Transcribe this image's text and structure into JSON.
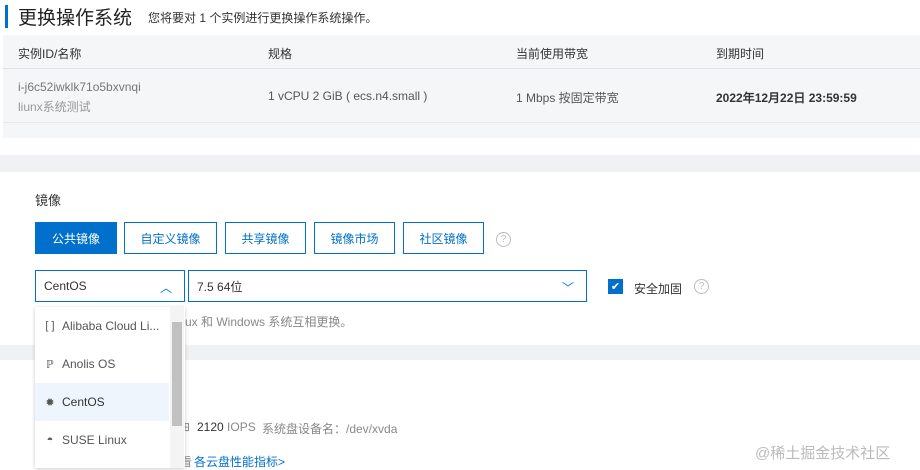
{
  "header": {
    "title": "更换操作系统",
    "subtitle": "您将要对 1 个实例进行更换操作系统操作。"
  },
  "table": {
    "columns": [
      "实例ID/名称",
      "规格",
      "当前使用带宽",
      "到期时间"
    ],
    "row": {
      "id": "i-j6c52iwklk71o5bxvnqi",
      "name": "liunx系统测试",
      "spec": "1 vCPU 2 GiB ( ecs.n4.small )",
      "bandwidth": "1 Mbps 按固定带宽",
      "expire": "2022年12月22日 23:59:59"
    }
  },
  "image": {
    "label": "镜像",
    "tabs": [
      "公共镜像",
      "自定义镜像",
      "共享镜像",
      "镜像市场",
      "社区镜像"
    ],
    "os_value": "CentOS",
    "version_value": "7.5 64位",
    "security_label": "安全加固",
    "security_checked": true,
    "hint": "ux 和 Windows 系统互相更换。",
    "options": [
      {
        "label": "Alibaba Cloud Li...",
        "icon": "alibaba-cloud-icon"
      },
      {
        "label": "Anolis OS",
        "icon": "anolis-icon"
      },
      {
        "label": "CentOS",
        "icon": "centos-icon",
        "selected": true
      },
      {
        "label": "SUSE Linux",
        "icon": "suse-icon"
      }
    ]
  },
  "disk": {
    "iops": "2120",
    "iops_unit": "IOPS",
    "device": "系统盘设备名：/dev/xvda",
    "link_prefix": "看",
    "link": "各云盘性能指标>"
  },
  "watermark": "@稀土掘金技术社区",
  "colors": {
    "accent": "#0070cc"
  }
}
